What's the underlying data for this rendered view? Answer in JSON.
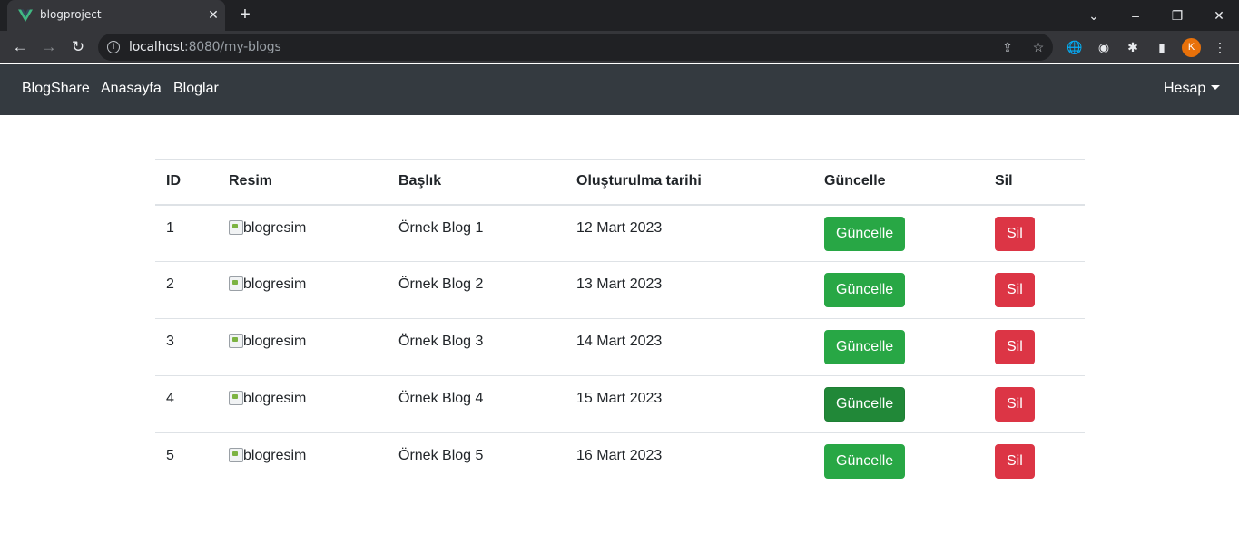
{
  "browser": {
    "tab_title": "blogproject",
    "url_host": "localhost",
    "url_path": ":8080/my-blogs",
    "profile_initial": "K"
  },
  "navbar": {
    "brand": "BlogShare",
    "links": [
      "Anasayfa",
      "Bloglar"
    ],
    "account": "Hesap"
  },
  "table": {
    "headers": [
      "ID",
      "Resim",
      "Başlık",
      "Oluşturulma tarihi",
      "Güncelle",
      "Sil"
    ],
    "rows": [
      {
        "id": "1",
        "image_alt": "blogresim",
        "title": "Örnek Blog 1",
        "date": "12 Mart 2023",
        "update": "Güncelle",
        "delete": "Sil"
      },
      {
        "id": "2",
        "image_alt": "blogresim",
        "title": "Örnek Blog 2",
        "date": "13 Mart 2023",
        "update": "Güncelle",
        "delete": "Sil"
      },
      {
        "id": "3",
        "image_alt": "blogresim",
        "title": "Örnek Blog 3",
        "date": "14 Mart 2023",
        "update": "Güncelle",
        "delete": "Sil"
      },
      {
        "id": "4",
        "image_alt": "blogresim",
        "title": "Örnek Blog 4",
        "date": "15 Mart 2023",
        "update": "Güncelle",
        "delete": "Sil"
      },
      {
        "id": "5",
        "image_alt": "blogresim",
        "title": "Örnek Blog 5",
        "date": "16 Mart 2023",
        "update": "Güncelle",
        "delete": "Sil"
      }
    ]
  },
  "colors": {
    "navbar_bg": "#343a40",
    "success": "#28a745",
    "danger": "#dc3545"
  }
}
